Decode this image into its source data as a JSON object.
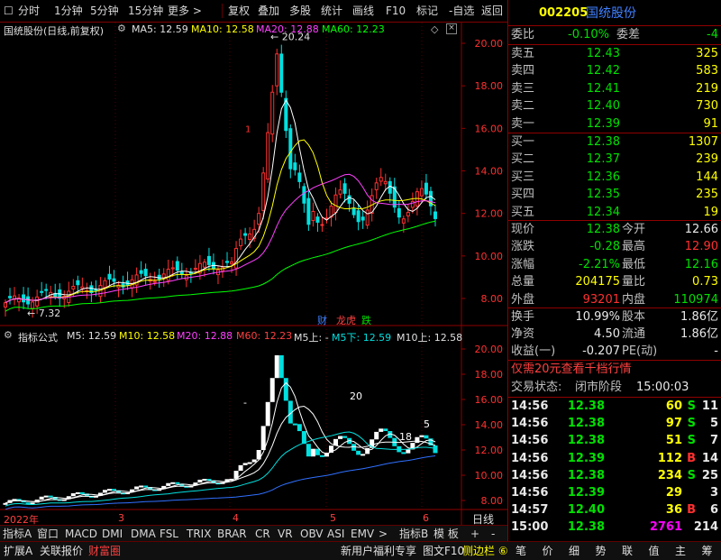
{
  "toolbar": {
    "items": [
      "分时",
      "1分钟",
      "5分钟",
      "15分钟",
      "更多 >",
      "复权",
      "叠加",
      "多股",
      "统计",
      "画线",
      "F10",
      "标记",
      "-自选",
      "返回"
    ]
  },
  "main_chart": {
    "title": "国统股份(日线,前复权)",
    "ma5_label": "MA5: 12.59",
    "ma10_label": "MA10: 12.58",
    "ma20_label": "MA20: 12.88",
    "ma60_label": "MA60: 12.23",
    "y_ticks": [
      "20.00",
      "18.00",
      "16.00",
      "14.00",
      "12.00",
      "10.00",
      "8.00"
    ],
    "peak_label": "20.24",
    "trough_label": "7.32",
    "badges": [
      "财",
      "龙虎",
      "跌"
    ],
    "marker_1": "1"
  },
  "indicator_chart": {
    "title": "指标公式",
    "m5_label": "M5: 12.59",
    "m10_label": "M10: 12.58",
    "m20_label": "M20: 12.88",
    "m60_label": "M60: 12.23",
    "m5up_label": "M5上: -",
    "m5down_label": "M5下: 12.59",
    "m10up_label": "M10上: 12.58",
    "y_ticks": [
      "20.00",
      "18.00",
      "16.00",
      "14.00",
      "12.00",
      "10.00",
      "8.00"
    ],
    "ann_20": "20",
    "ann_5": "5",
    "ann_18": "18",
    "ann_dash": "-"
  },
  "x_axis": {
    "labels": [
      "2022年",
      "3",
      "4",
      "5",
      "6"
    ],
    "right_label": "日线"
  },
  "tabs": [
    "指标A",
    "窗口",
    "MACD",
    "DMI",
    "DMA",
    "FSL",
    "TRIX",
    "BRAR",
    "CR",
    "VR",
    "OBV",
    "ASI",
    "EMV",
    ">",
    "指标B",
    "模 板",
    "+",
    "-"
  ],
  "stock": {
    "code": "002205",
    "name": "国统股份"
  },
  "order_book": {
    "webi_label": "委比",
    "webi_value": "-0.10%",
    "weicha_label": "委差",
    "weicha_value": "-4",
    "asks": [
      {
        "label": "卖五",
        "price": "12.43",
        "vol": "325"
      },
      {
        "label": "卖四",
        "price": "12.42",
        "vol": "583"
      },
      {
        "label": "卖三",
        "price": "12.41",
        "vol": "219"
      },
      {
        "label": "卖二",
        "price": "12.40",
        "vol": "730"
      },
      {
        "label": "卖一",
        "price": "12.39",
        "vol": "91"
      }
    ],
    "bids": [
      {
        "label": "买一",
        "price": "12.38",
        "vol": "1307"
      },
      {
        "label": "买二",
        "price": "12.37",
        "vol": "239"
      },
      {
        "label": "买三",
        "price": "12.36",
        "vol": "144"
      },
      {
        "label": "买四",
        "price": "12.35",
        "vol": "235"
      },
      {
        "label": "买五",
        "price": "12.34",
        "vol": "19"
      }
    ]
  },
  "quote": {
    "rows": [
      {
        "l1": "现价",
        "v1": "12.38",
        "l2": "今开",
        "v2": "12.66"
      },
      {
        "l1": "涨跌",
        "v1": "-0.28",
        "l2": "最高",
        "v2": "12.90"
      },
      {
        "l1": "涨幅",
        "v1": "-2.21%",
        "l2": "最低",
        "v2": "12.16"
      },
      {
        "l1": "总量",
        "v1": "204175",
        "l2": "量比",
        "v2": "0.73"
      },
      {
        "l1": "外盘",
        "v1": "93201",
        "l2": "内盘",
        "v2": "110974"
      }
    ],
    "rows2": [
      {
        "l1": "换手",
        "v1": "10.99%",
        "l2": "股本",
        "v2": "1.86亿"
      },
      {
        "l1": "净资",
        "v1": "4.50",
        "l2": "流通",
        "v2": "1.86亿"
      },
      {
        "l1": "收益(一)",
        "v1": "-0.207",
        "l2": "PE(动)",
        "v2": "-"
      }
    ]
  },
  "promo": "仅需20元查看千档行情",
  "trade_status": {
    "label": "交易状态:",
    "value": "闭市阶段",
    "time": "15:00:03"
  },
  "ticks": [
    {
      "time": "14:56",
      "price": "12.38",
      "vol": "60",
      "side": "S",
      "n": "11"
    },
    {
      "time": "14:56",
      "price": "12.38",
      "vol": "97",
      "side": "S",
      "n": "5"
    },
    {
      "time": "14:56",
      "price": "12.38",
      "vol": "51",
      "side": "S",
      "n": "7"
    },
    {
      "time": "14:56",
      "price": "12.39",
      "vol": "112",
      "side": "B",
      "n": "14"
    },
    {
      "time": "14:56",
      "price": "12.38",
      "vol": "234",
      "side": "S",
      "n": "25"
    },
    {
      "time": "14:56",
      "price": "12.39",
      "vol": "29",
      "side": "",
      "n": "3"
    },
    {
      "time": "14:57",
      "price": "12.40",
      "vol": "36",
      "side": "B",
      "n": "6"
    },
    {
      "time": "15:00",
      "price": "12.38",
      "vol": "2761",
      "side": "",
      "n": "214"
    }
  ],
  "statusbar": {
    "left": [
      "扩展A",
      "关联报价",
      "财富圈"
    ],
    "promo": "新用户福利专享",
    "f10": "图文F10",
    "sidebar": "侧边栏 ⑥",
    "right_tabs": [
      "笔",
      "价",
      "细",
      "势",
      "联",
      "值",
      "主",
      "筹"
    ]
  },
  "colors": {
    "up": "#ff3030",
    "down": "#00e0e0",
    "ma5": "#ffffff",
    "ma10": "#ffff00",
    "ma20": "#ff40ff",
    "ma60": "#00ff00",
    "grid": "#800000"
  }
}
